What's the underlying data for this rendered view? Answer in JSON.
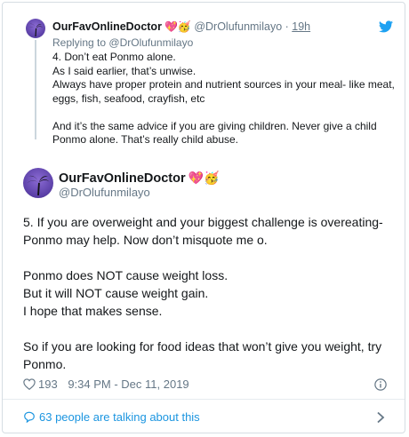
{
  "quoted_tweet": {
    "display_name": "OurFavOnlineDoctor",
    "name_emojis": "💖🥳",
    "handle": "@DrOlufunmilayo",
    "separator": "·",
    "time": "19h",
    "replying_to_prefix": "Replying to",
    "replying_to_handle": "@DrOlufunmilayo",
    "lines": [
      "4. Don’t eat Ponmo alone.",
      "As I said earlier, that’s unwise.",
      "Always have proper protein and nutrient sources in your meal- like meat, eggs, fish, seafood, crayfish, etc",
      "And it’s the same advice if you are giving children. Never give a child Ponmo alone. That’s really child abuse."
    ]
  },
  "main_tweet": {
    "display_name": "OurFavOnlineDoctor",
    "name_emojis": "💖🥳",
    "handle": "@DrOlufunmilayo",
    "paragraphs": [
      [
        "5. If you are overweight and your biggest challenge is overeating- Ponmo may help. Now don’t misquote me o."
      ],
      [
        "Ponmo does NOT cause weight loss.",
        "But it will NOT cause weight gain.",
        "I hope that makes sense."
      ],
      [
        "So if you are looking for food ideas that won’t give you weight, try Ponmo."
      ]
    ],
    "like_count": "193",
    "timestamp": "9:34 PM - Dec 11, 2019"
  },
  "footer": {
    "talking_text": "63 people are talking about this"
  },
  "colors": {
    "link_blue": "#1b95e0",
    "muted_gray": "#657786",
    "avatar_purple": "#5a3fa6",
    "border": "#d6dde3"
  },
  "icons": [
    "twitter-bird-icon",
    "heart-icon",
    "info-icon",
    "speech-bubble-icon",
    "chevron-right-icon"
  ]
}
